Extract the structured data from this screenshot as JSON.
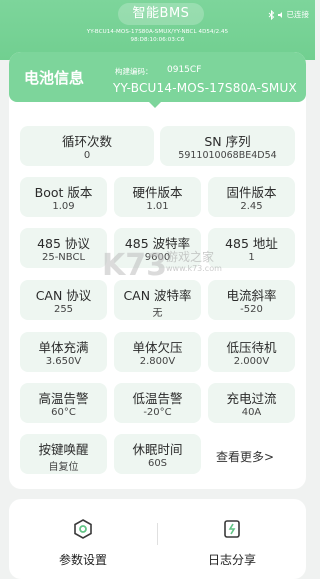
{
  "header": {
    "title": "智能BMS",
    "connection_status": "已连接",
    "device_line1": "YY-BCU14-MOS-17S80A-SMUX/YY-NBCL 4D54/2.45",
    "device_line2": "98:D8:10:06:03:C6"
  },
  "battery": {
    "title": "电池信息",
    "code_label": "构建编码：",
    "code_value": "0915CF",
    "model": "YY-BCU14-MOS-17S80A-SMUX"
  },
  "tiles": [
    {
      "label": "循环次数",
      "value": "0"
    },
    {
      "label": "SN 序列",
      "value": "5911010068BE4D54"
    },
    {
      "label": "Boot 版本",
      "value": "1.09"
    },
    {
      "label": "硬件版本",
      "value": "1.01"
    },
    {
      "label": "固件版本",
      "value": "2.45"
    },
    {
      "label": "485 协议",
      "value": "25-NBCL"
    },
    {
      "label": "485 波特率",
      "value": "9600"
    },
    {
      "label": "485 地址",
      "value": "1"
    },
    {
      "label": "CAN 协议",
      "value": "255"
    },
    {
      "label": "CAN 波特率",
      "value": "无"
    },
    {
      "label": "电流斜率",
      "value": "-520"
    },
    {
      "label": "单体充满",
      "value": "3.650V"
    },
    {
      "label": "单体欠压",
      "value": "2.800V"
    },
    {
      "label": "低压待机",
      "value": "2.000V"
    },
    {
      "label": "高温告警",
      "value": "60°C"
    },
    {
      "label": "低温告警",
      "value": "-20°C"
    },
    {
      "label": "充电过流",
      "value": "40A"
    },
    {
      "label": "按键唤醒",
      "value": "自复位"
    },
    {
      "label": "休眠时间",
      "value": "60S"
    }
  ],
  "more_label": "查看更多>",
  "bottom": {
    "settings_label": "参数设置",
    "log_label": "日志分享"
  },
  "watermark": {
    "mark": "K73",
    "text1": "游戏之家",
    "text2": "www.k73.com"
  }
}
